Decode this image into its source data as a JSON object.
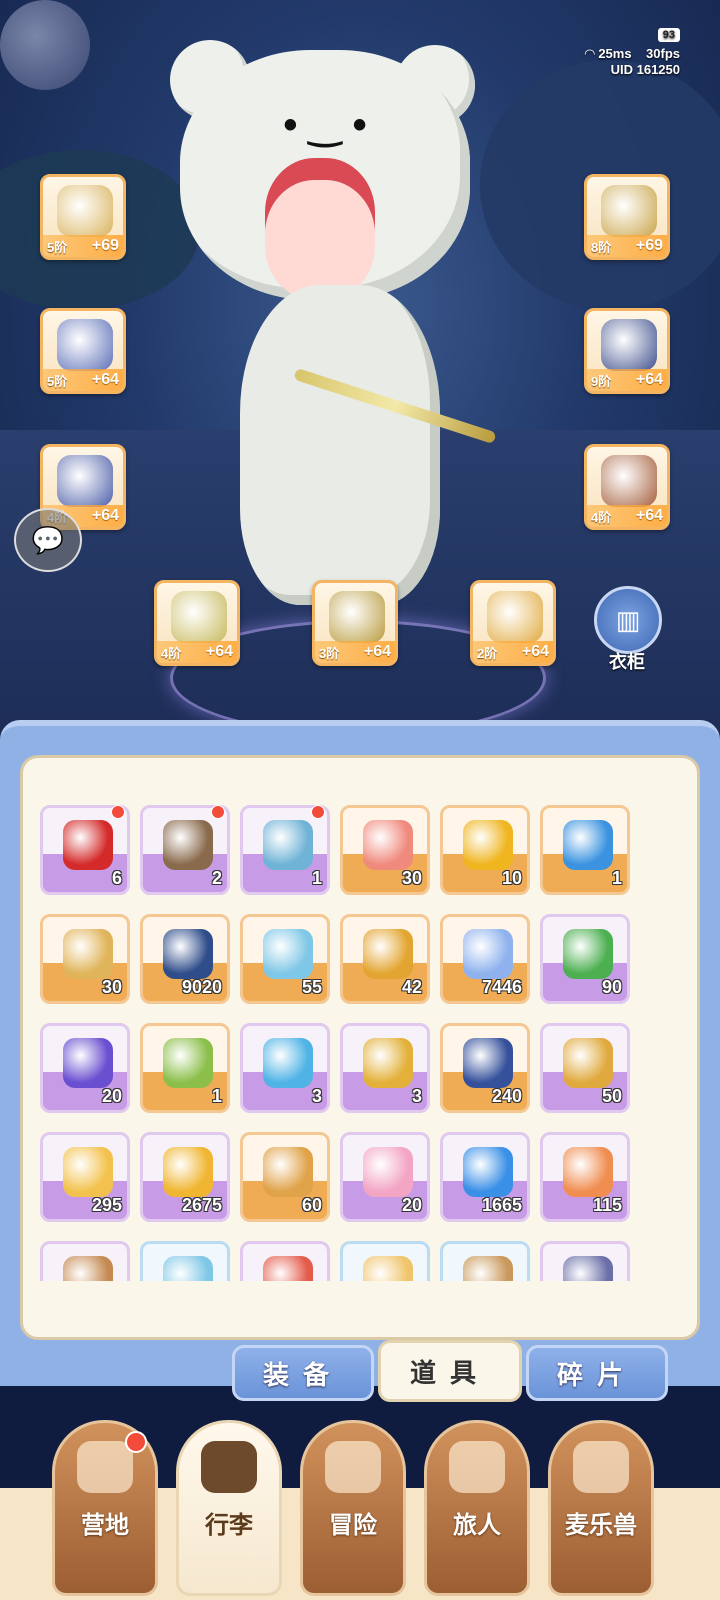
{
  "hud": {
    "battery": "93",
    "ping": "25ms",
    "fps": "30fps",
    "uid": "UID 161250"
  },
  "equipment": [
    {
      "name": "weapon-bow-slot",
      "rank": "5阶",
      "plus": "+69",
      "icon": "bow",
      "color": "#d9b25b"
    },
    {
      "name": "helmet-slot",
      "rank": "8阶",
      "plus": "+69",
      "icon": "helmet",
      "color": "#c9a447"
    },
    {
      "name": "armor-slot",
      "rank": "5阶",
      "plus": "+64",
      "icon": "armor",
      "color": "#5b6fb8"
    },
    {
      "name": "gauntlet-slot",
      "rank": "9阶",
      "plus": "+64",
      "icon": "gauntlet",
      "color": "#3e4f8c"
    },
    {
      "name": "pants-slot",
      "rank": "4阶",
      "plus": "+64",
      "icon": "pants",
      "color": "#4c5ea8"
    },
    {
      "name": "boots-slot",
      "rank": "4阶",
      "plus": "+64",
      "icon": "boots",
      "color": "#a45d3a"
    },
    {
      "name": "ring-slot",
      "rank": "4阶",
      "plus": "+64",
      "icon": "ring",
      "color": "#c6b85a"
    },
    {
      "name": "necklace-slot",
      "rank": "3阶",
      "plus": "+64",
      "icon": "necklace",
      "color": "#b89a3c"
    },
    {
      "name": "earring-slot",
      "rank": "2阶",
      "plus": "+64",
      "icon": "earring",
      "color": "#e0a93d"
    }
  ],
  "wardrobe_label": "衣柜",
  "items": [
    {
      "icon": "apple-icon",
      "count": "6",
      "rarity": "purple",
      "dot": true,
      "color": "#d42a2a"
    },
    {
      "icon": "treasure-chest-icon",
      "count": "2",
      "rarity": "purple",
      "dot": true,
      "color": "#8a6a4c"
    },
    {
      "icon": "crystal-chest-icon",
      "count": "1",
      "rarity": "purple",
      "dot": true,
      "color": "#6fb3d6"
    },
    {
      "icon": "ticket-icon",
      "count": "30",
      "rarity": "orange",
      "dot": false,
      "color": "#f08a7d"
    },
    {
      "icon": "gold-gem-icon",
      "count": "10",
      "rarity": "orange",
      "dot": false,
      "color": "#f0b51f"
    },
    {
      "icon": "blue-potion-icon",
      "count": "1",
      "rarity": "orange",
      "dot": false,
      "color": "#3b93e0"
    },
    {
      "icon": "harp-icon",
      "count": "30",
      "rarity": "orange",
      "dot": false,
      "color": "#e0b45a"
    },
    {
      "icon": "portal-orb-icon",
      "count": "9020",
      "rarity": "orange",
      "dot": false,
      "color": "#2f4d8a"
    },
    {
      "icon": "ice-crystal-icon",
      "count": "55",
      "rarity": "orange",
      "dot": false,
      "color": "#7ec7e6"
    },
    {
      "icon": "bell-icon",
      "count": "42",
      "rarity": "orange",
      "dot": false,
      "color": "#e3a531"
    },
    {
      "icon": "star-crystal-icon",
      "count": "7446",
      "rarity": "orange",
      "dot": false,
      "color": "#8fb2ee"
    },
    {
      "icon": "bear-emblem-icon",
      "count": "90",
      "rarity": "purple",
      "dot": false,
      "color": "#4caf50"
    },
    {
      "icon": "purple-gem-icon",
      "count": "20",
      "rarity": "purple",
      "dot": false,
      "color": "#6a4fd0"
    },
    {
      "icon": "house-plant-icon",
      "count": "1",
      "rarity": "orange",
      "dot": false,
      "color": "#8bbf4a"
    },
    {
      "icon": "potion-bottle-icon",
      "count": "3",
      "rarity": "purple",
      "dot": false,
      "color": "#4fb3e6"
    },
    {
      "icon": "golden-key-icon",
      "count": "3",
      "rarity": "purple",
      "dot": false,
      "color": "#e3b13a"
    },
    {
      "icon": "card-icon",
      "count": "240",
      "rarity": "orange",
      "dot": false,
      "color": "#35519c"
    },
    {
      "icon": "cat-mirror-icon",
      "count": "50",
      "rarity": "purple",
      "dot": false,
      "color": "#e0a93d"
    },
    {
      "icon": "cheese-icon",
      "count": "295",
      "rarity": "purple",
      "dot": false,
      "color": "#f3c24e"
    },
    {
      "icon": "golden-leaf-icon",
      "count": "2675",
      "rarity": "purple",
      "dot": false,
      "color": "#f0b632"
    },
    {
      "icon": "star-cookie-icon",
      "count": "60",
      "rarity": "orange",
      "dot": false,
      "color": "#e0a34a"
    },
    {
      "icon": "paint-tube-icon",
      "count": "20",
      "rarity": "purple",
      "dot": false,
      "color": "#f3a6c4"
    },
    {
      "icon": "blue-slime-icon",
      "count": "1665",
      "rarity": "purple",
      "dot": false,
      "color": "#3a8fe6"
    },
    {
      "icon": "recipe-book-icon",
      "count": "115",
      "rarity": "purple",
      "dot": false,
      "color": "#f08e52"
    },
    {
      "icon": "scroll-icon",
      "count": "",
      "rarity": "purple",
      "dot": false,
      "color": "#c58a52"
    },
    {
      "icon": "ice-shard-icon",
      "count": "",
      "rarity": "blue",
      "dot": false,
      "color": "#7ec7e6"
    },
    {
      "icon": "red-ticket-icon",
      "count": "",
      "rarity": "purple",
      "dot": false,
      "color": "#e35b4b"
    },
    {
      "icon": "cat-bag-icon",
      "count": "",
      "rarity": "blue",
      "dot": false,
      "color": "#f0c46a"
    },
    {
      "icon": "basket-icon",
      "count": "",
      "rarity": "blue",
      "dot": false,
      "color": "#c9985a"
    },
    {
      "icon": "box-icon",
      "count": "",
      "rarity": "purple",
      "dot": false,
      "color": "#6b6fa8"
    }
  ],
  "tabs": [
    {
      "label": "装备",
      "active": false
    },
    {
      "label": "道具",
      "active": true
    },
    {
      "label": "碎片",
      "active": false
    }
  ],
  "nav": [
    {
      "label": "营地",
      "icon": "castle-icon",
      "active": false,
      "dot": true
    },
    {
      "label": "行李",
      "icon": "backpack-icon",
      "active": true,
      "dot": false
    },
    {
      "label": "冒险",
      "icon": "crossed-swords-icon",
      "active": false,
      "dot": false
    },
    {
      "label": "旅人",
      "icon": "traveler-icon",
      "active": false,
      "dot": false
    },
    {
      "label": "麦乐兽",
      "icon": "cat-pet-icon",
      "active": false,
      "dot": false
    }
  ]
}
